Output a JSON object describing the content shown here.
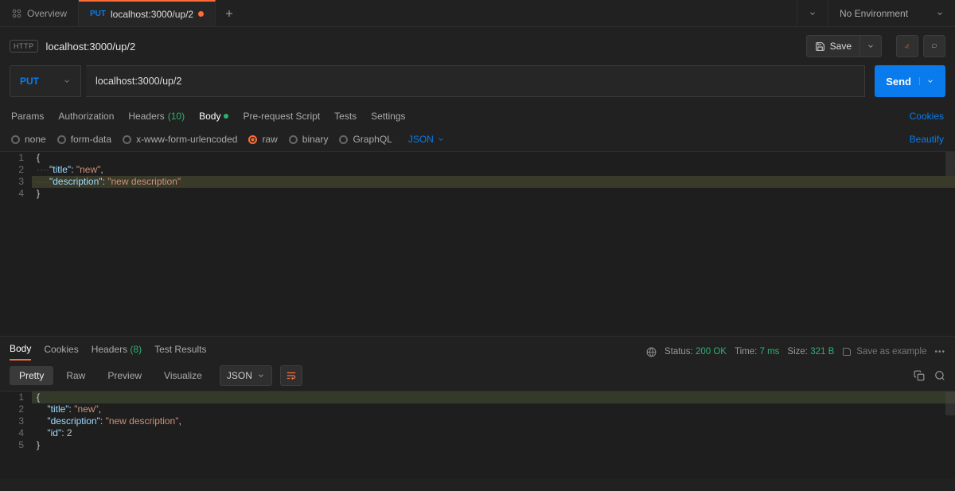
{
  "tabs": {
    "overview_label": "Overview",
    "active_method": "PUT",
    "active_title": "localhost:3000/up/2"
  },
  "environment": {
    "selected": "No Environment"
  },
  "header": {
    "http_badge": "HTTP",
    "title": "localhost:3000/up/2",
    "save_label": "Save"
  },
  "request": {
    "method": "PUT",
    "url": "localhost:3000/up/2",
    "send_label": "Send"
  },
  "req_tabs": {
    "params": "Params",
    "authorization": "Authorization",
    "headers": "Headers",
    "headers_count": "(10)",
    "body": "Body",
    "prerequest": "Pre-request Script",
    "tests": "Tests",
    "settings": "Settings",
    "cookies_link": "Cookies"
  },
  "body_types": {
    "none": "none",
    "formdata": "form-data",
    "xwww": "x-www-form-urlencoded",
    "raw": "raw",
    "binary": "binary",
    "graphql": "GraphQL",
    "json_dd": "JSON",
    "beautify": "Beautify"
  },
  "request_body": {
    "lines": [
      "1",
      "2",
      "3",
      "4"
    ],
    "l1": "{",
    "l2_key": "\"title\"",
    "l2_sep": ": ",
    "l2_val": "\"new\"",
    "l2_comma": ",",
    "l3_key": "\"description\"",
    "l3_sep": ": ",
    "l3_val": "\"new description\"",
    "l4": "}",
    "indent_dots": "····"
  },
  "response_tabs": {
    "body": "Body",
    "cookies": "Cookies",
    "headers": "Headers",
    "headers_count": "(8)",
    "test_results": "Test Results"
  },
  "response_meta": {
    "status_label": "Status:",
    "status_value": "200 OK",
    "time_label": "Time:",
    "time_value": "7 ms",
    "size_label": "Size:",
    "size_value": "321 B",
    "save_example": "Save as example"
  },
  "response_format": {
    "pretty": "Pretty",
    "raw": "Raw",
    "preview": "Preview",
    "visualize": "Visualize",
    "json": "JSON"
  },
  "response_body": {
    "lines": [
      "1",
      "2",
      "3",
      "4",
      "5"
    ],
    "l1": "{",
    "l2_key": "\"title\"",
    "l2_val": "\"new\"",
    "l2_comma": ",",
    "l3_key": "\"description\"",
    "l3_val": "\"new description\"",
    "l3_comma": ",",
    "l4_key": "\"id\"",
    "l4_val": "2",
    "l5": "}",
    "sep": ": ",
    "indent4": "    "
  }
}
